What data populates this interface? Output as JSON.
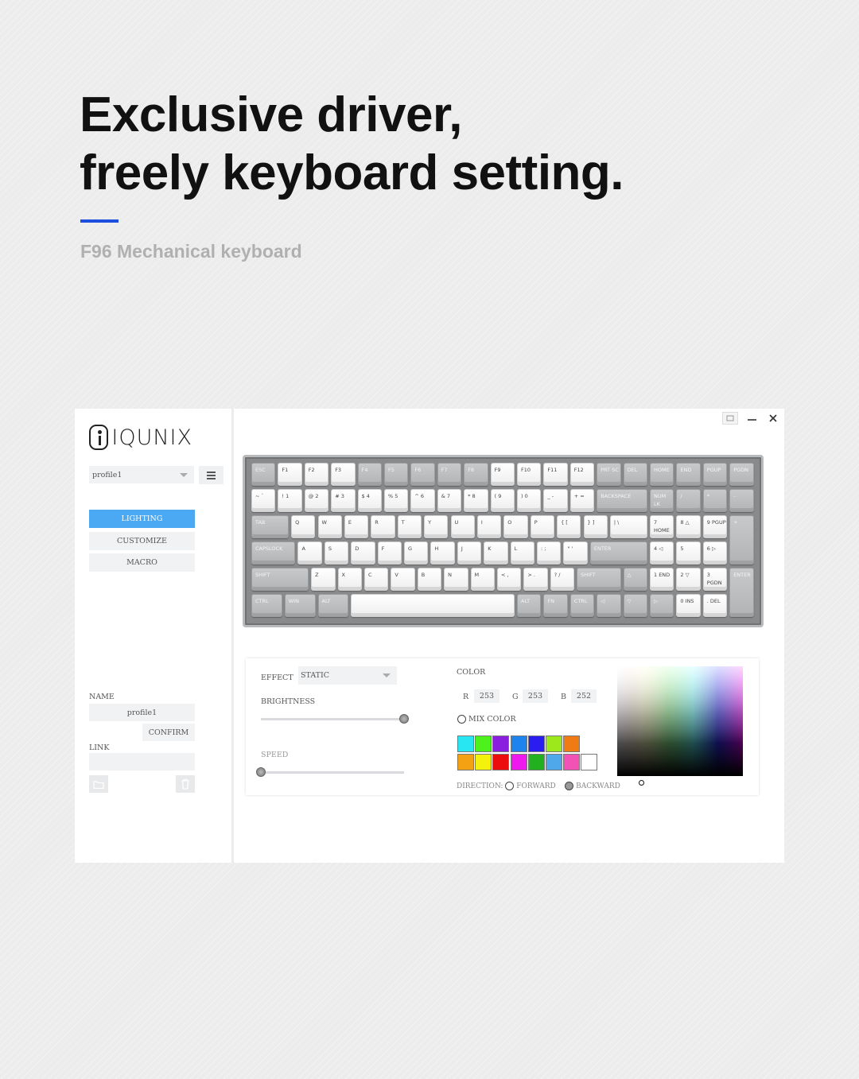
{
  "headline": {
    "line1": "Exclusive driver,",
    "line2": "freely keyboard setting."
  },
  "subtitle": "F96 Mechanical keyboard",
  "colors": {
    "accent_bar": "#1c4fe0",
    "active_nav": "#4aa9f2"
  },
  "app": {
    "brand": "IQUNIX",
    "profile_selected": "profile1",
    "nav": {
      "lighting": "LIGHTING",
      "customize": "CUSTOMIZE",
      "macro": "MACRO"
    },
    "name_label": "NAME",
    "name_value": "profile1",
    "confirm": "CONFIRM",
    "link_label": "LINK",
    "link_value": "",
    "icons": {
      "folder": "folder-icon",
      "trash": "trash-icon",
      "menu": "menu-icon",
      "minimize": "minimize-icon",
      "close": "close-icon",
      "restore": "window-icon"
    }
  },
  "keyboard": {
    "rows": [
      [
        "ESC",
        "F1",
        "F2",
        "F3",
        "F4",
        "F5",
        "F6",
        "F7",
        "F8",
        "F9",
        "F10",
        "F11",
        "F12",
        "PRT SC",
        "DEL",
        "HOME",
        "END",
        "PGUP",
        "PGDN"
      ],
      [
        "~ `",
        "! 1",
        "@ 2",
        "# 3",
        "$ 4",
        "% 5",
        "^ 6",
        "& 7",
        "* 8",
        "( 9",
        ") 0",
        "_ -",
        "+ =",
        "BACKSPACE",
        "NUM LK",
        "/",
        "*",
        "-"
      ],
      [
        "TAB",
        "Q",
        "W",
        "E",
        "R",
        "T",
        "Y",
        "U",
        "I",
        "O",
        "P",
        "{ [",
        "} ]",
        "| \\",
        "7 HOME",
        "8 △",
        "9 PGUP",
        "+"
      ],
      [
        "CAPSLOCK",
        "A",
        "S",
        "D",
        "F",
        "G",
        "H",
        "J",
        "K",
        "L",
        ": ;",
        "\" '",
        "ENTER",
        "4 ◁",
        "5",
        "6 ▷"
      ],
      [
        "SHIFT",
        "Z",
        "X",
        "C",
        "V",
        "B",
        "N",
        "M",
        "< ,",
        "> .",
        "? /",
        "SHIFT",
        "△",
        "1 END",
        "2 ▽",
        "3 PGDN",
        "ENTER"
      ],
      [
        "CTRL",
        "WIN",
        "ALT",
        "",
        "ALT",
        "FN",
        "CTRL",
        "◁",
        "▽",
        "▷",
        "0 INS",
        ". DEL"
      ]
    ]
  },
  "lighting": {
    "effect_label": "EFFECT",
    "effect_value": "STATIC",
    "brightness_label": "BRIGHTNESS",
    "brightness": 1.0,
    "speed_label": "SPEED",
    "speed": 0.0,
    "color_label": "COLOR",
    "r_label": "R",
    "r": "253",
    "g_label": "G",
    "g": "253",
    "b_label": "B",
    "b": "252",
    "mix_color": "MIX COLOR",
    "direction_label": "DIRECTION:",
    "forward": "FORWARD",
    "backward": "BACKWARD",
    "swatches": [
      "#29e7f2",
      "#4df21c",
      "#8a1fe0",
      "#1c84ec",
      "#2a1df0",
      "#9ce81b",
      "#f07a14",
      "#f5a114",
      "#f4f20c",
      "#ec0e0e",
      "#ef18ef",
      "#22b021",
      "#4ea8ea",
      "#f252b4",
      "#ffffff"
    ]
  }
}
